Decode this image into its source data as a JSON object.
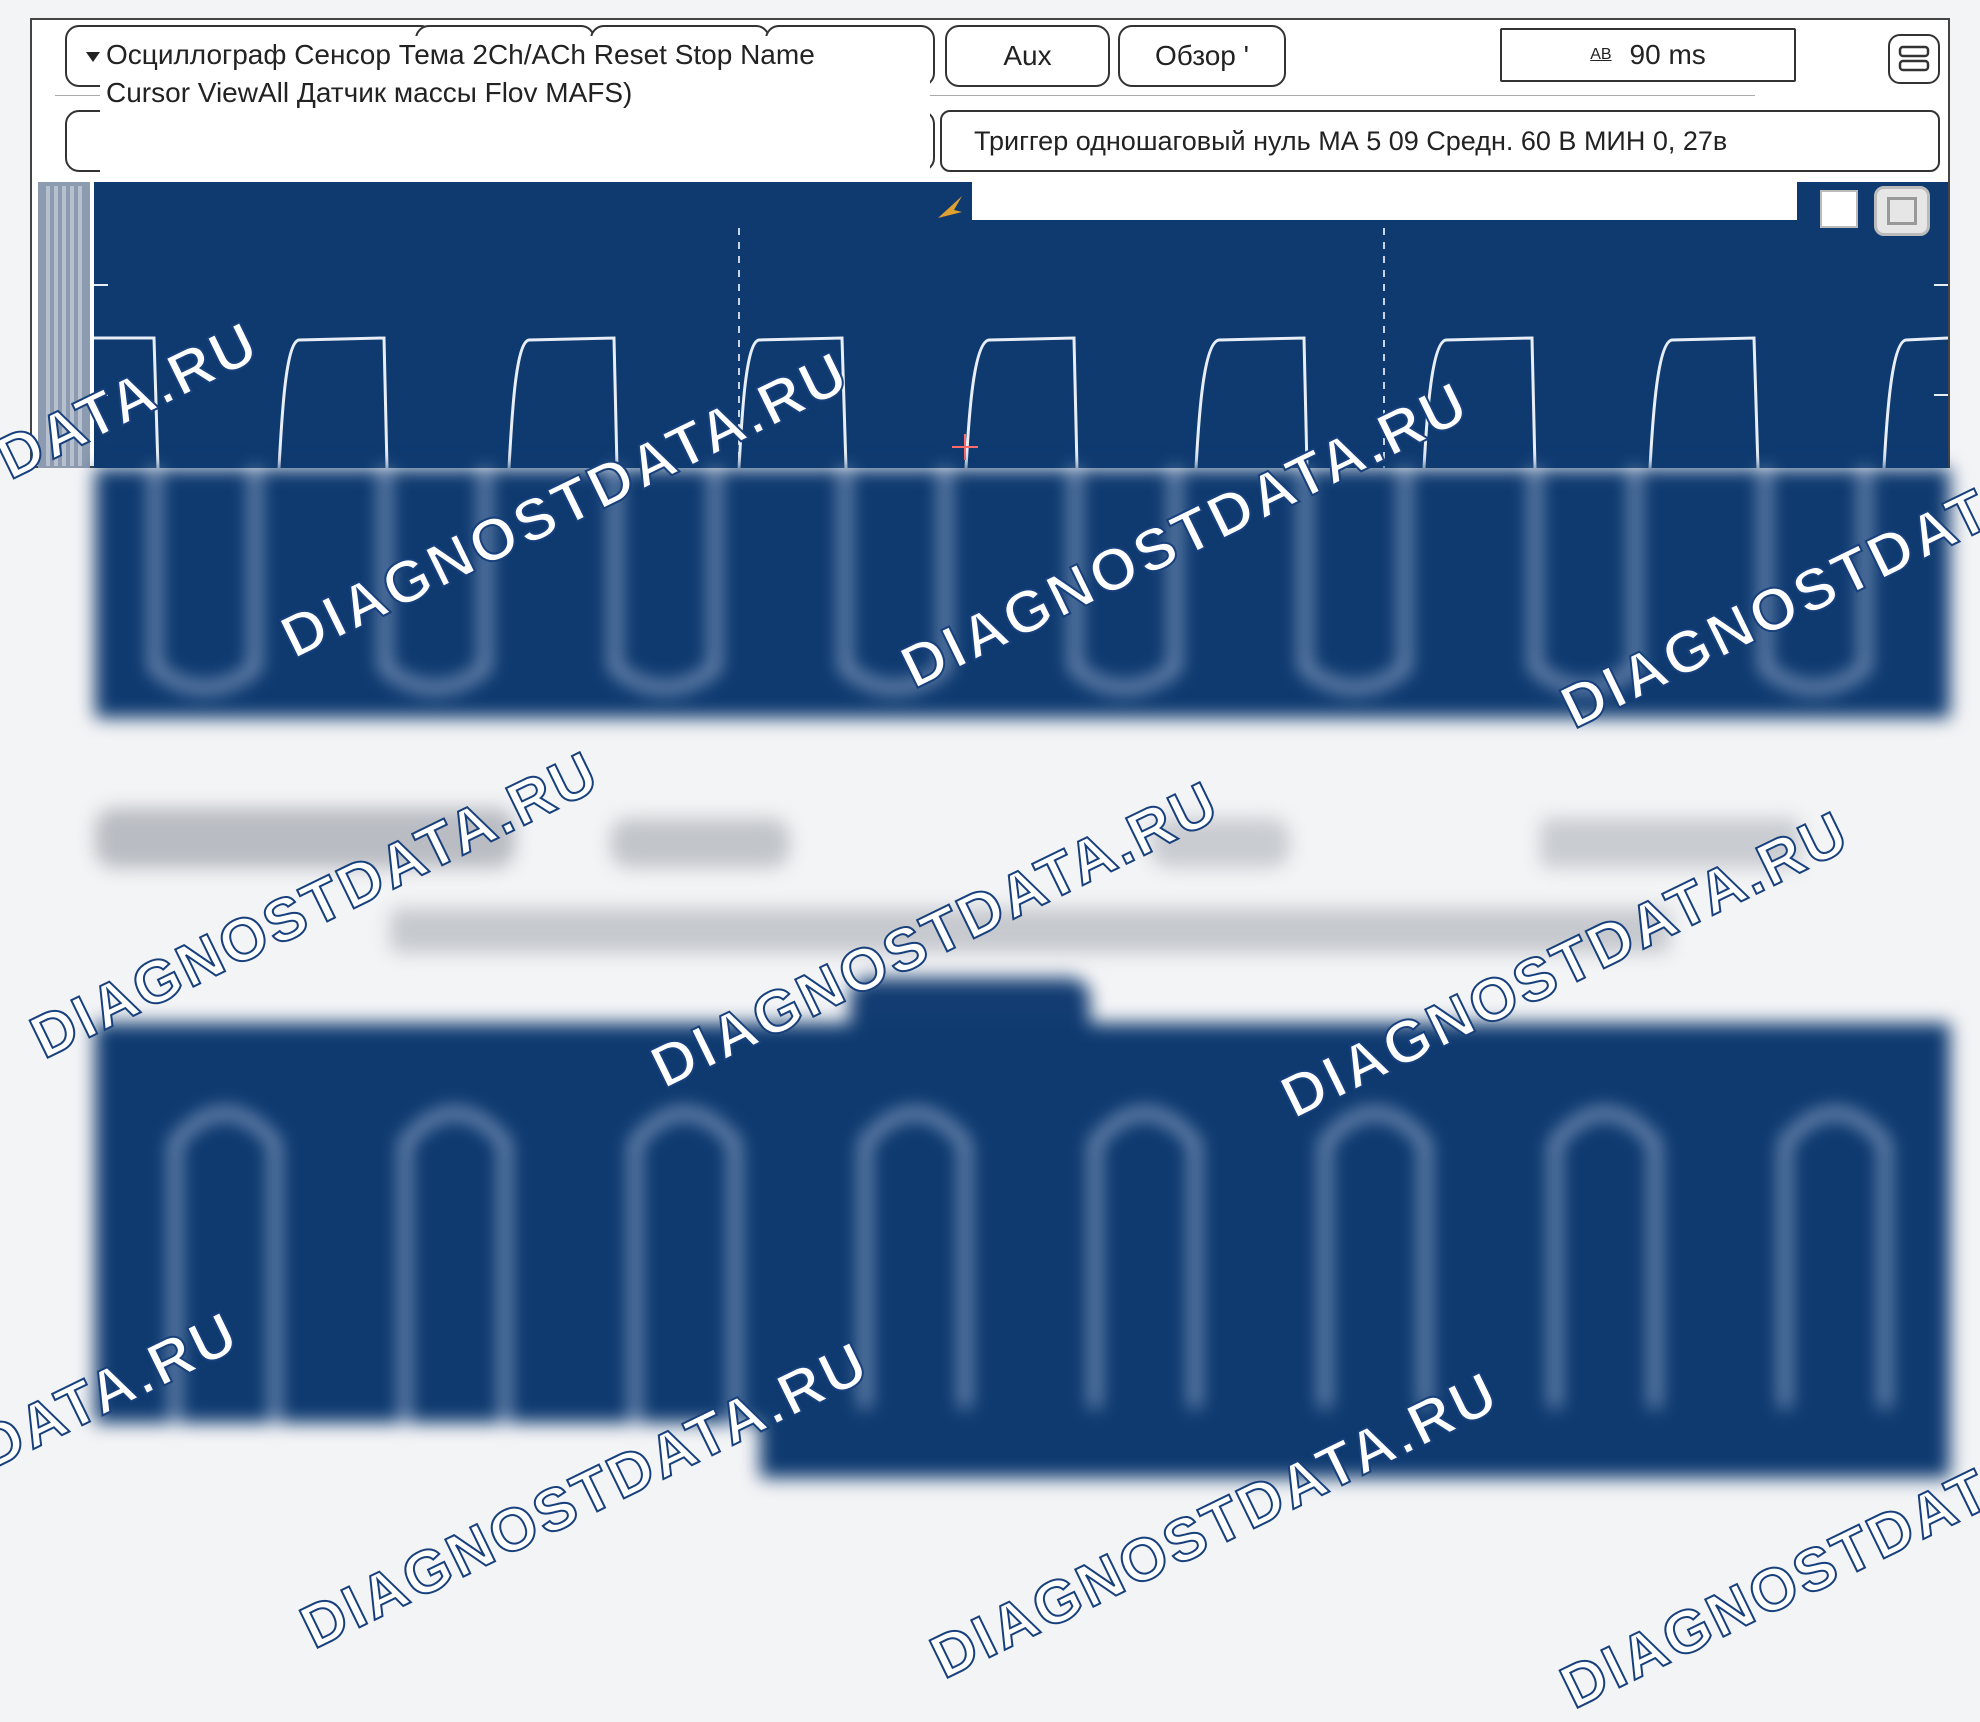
{
  "toolbar": {
    "menu_line1": "Осциллограф Сенсор Тема 2Ch/ACh Reset Stop Name",
    "menu_line2": "Cursor ViewAll Датчик массы Flov MAFS)",
    "aux_label": "Aux",
    "overview_label": "Обзор '",
    "timebase_icon": "AB",
    "timebase_value": "90 ms"
  },
  "trigger_bar": {
    "text": "Триггер одношаговый нуль МА 5 09 Средн. 60 В МИН 0, 27в"
  },
  "watermark": {
    "text": "DIAGNOSTDATA.RU"
  },
  "colors": {
    "screen_bg": "#0e3a70",
    "trace": "#e8eef6",
    "cursor": "#ff6b6b",
    "marker": "#e0a030"
  },
  "icons": [
    "window-menu-icon",
    "trigger-marker-icon",
    "cursor-crosshair-icon",
    "view-toggle-icon",
    "restore-icon",
    "sidebar-scroll-icon"
  ]
}
